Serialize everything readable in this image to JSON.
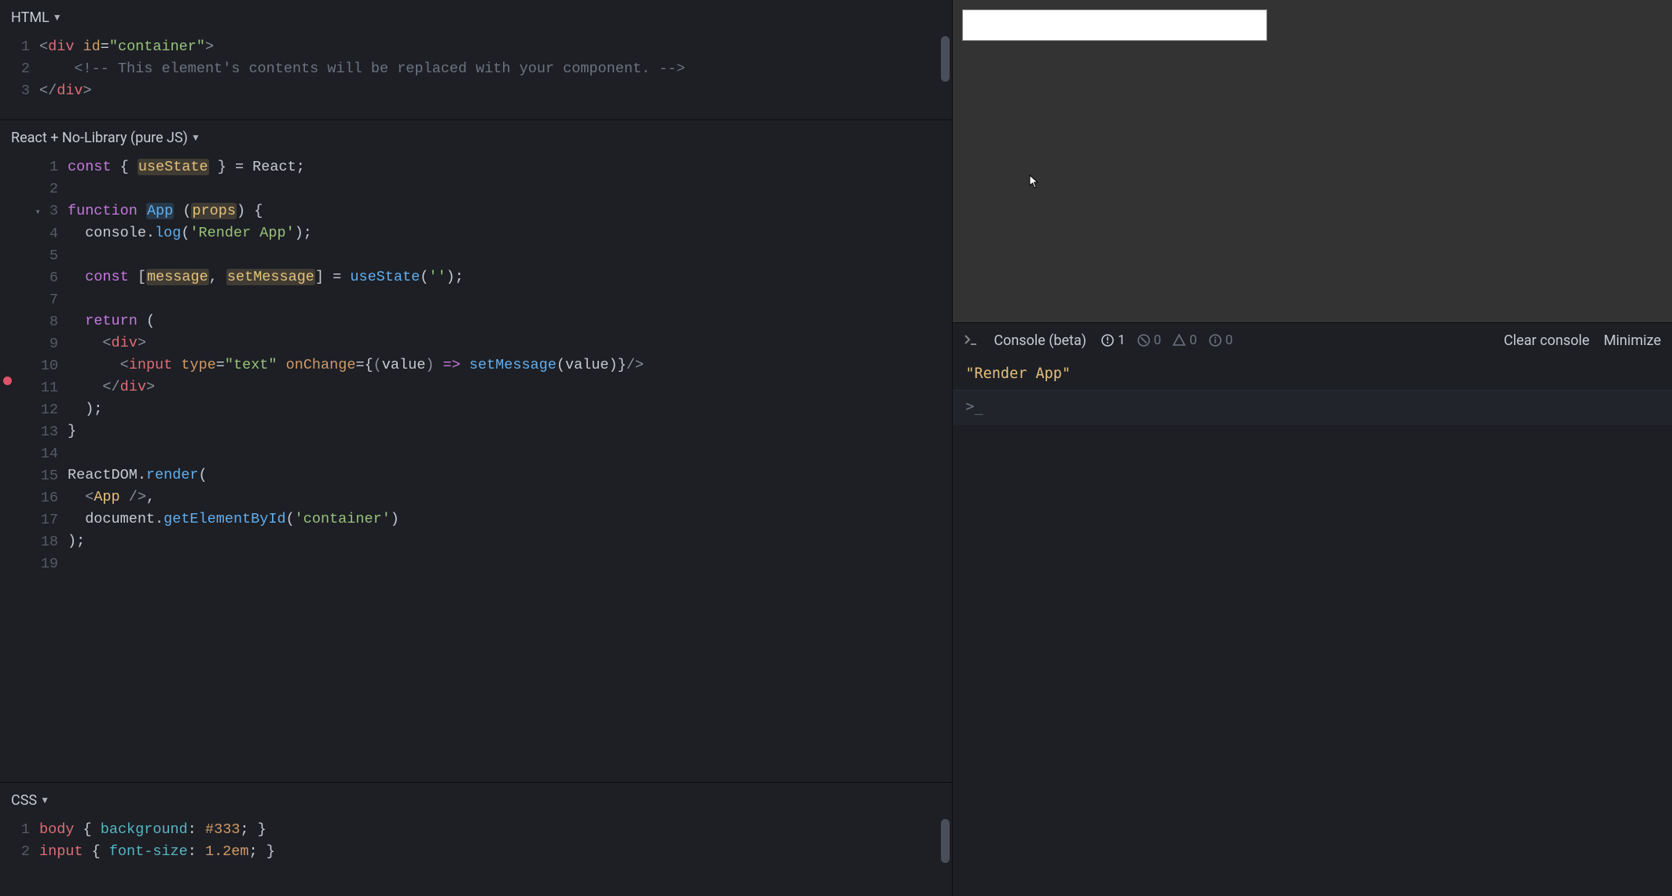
{
  "panels": {
    "html": {
      "label": "HTML"
    },
    "js": {
      "label": "React + No-Library (pure JS)"
    },
    "css": {
      "label": "CSS"
    }
  },
  "html_editor": {
    "lines": [
      "1",
      "2",
      "3"
    ]
  },
  "js_editor": {
    "lines": [
      "1",
      "2",
      "3",
      "4",
      "5",
      "6",
      "7",
      "8",
      "9",
      "10",
      "11",
      "12",
      "13",
      "14",
      "15",
      "16",
      "17",
      "18",
      "19"
    ],
    "breakpoint_line": "11"
  },
  "css_editor": {
    "lines": [
      "1",
      "2"
    ]
  },
  "source": {
    "html": "<div id=\"container\">\n    <!-- This element's contents will be replaced with your component. -->\n</div>",
    "js": "const { useState } = React;\n\nfunction App (props) {\n  console.log('Render App');\n\n  const [message, setMessage] = useState('');\n\n  return (\n    <div>\n      <input type=\"text\" onChange={(value) => setMessage(value)}/>\n    </div>\n  );\n}\n\nReactDOM.render(\n  <App />,\n  document.getElementById('container')\n);",
    "css": "body { background: #333; }\ninput { font-size: 1.2em; }"
  },
  "console": {
    "title": "Console (beta)",
    "counts": {
      "log": "1",
      "debug": "0",
      "warn": "0",
      "info": "0"
    },
    "clear": "Clear console",
    "minimize": "Minimize",
    "entries": [
      "\"Render App\""
    ],
    "prompt": ">_"
  },
  "preview": {
    "input_value": ""
  }
}
